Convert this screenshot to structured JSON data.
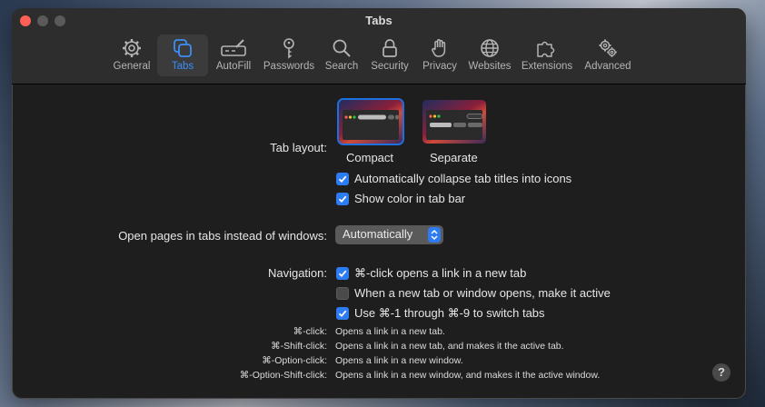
{
  "window": {
    "title": "Tabs"
  },
  "toolbar": {
    "items": [
      {
        "label": "General",
        "icon": "gear-icon"
      },
      {
        "label": "Tabs",
        "icon": "tabs-icon",
        "active": true
      },
      {
        "label": "AutoFill",
        "icon": "pencil-field-icon"
      },
      {
        "label": "Passwords",
        "icon": "key-icon"
      },
      {
        "label": "Search",
        "icon": "magnifier-icon"
      },
      {
        "label": "Security",
        "icon": "lock-icon"
      },
      {
        "label": "Privacy",
        "icon": "hand-icon"
      },
      {
        "label": "Websites",
        "icon": "globe-icon"
      },
      {
        "label": "Extensions",
        "icon": "puzzle-icon"
      },
      {
        "label": "Advanced",
        "icon": "gears-icon"
      }
    ]
  },
  "tab_layout": {
    "label": "Tab layout:",
    "options": [
      {
        "label": "Compact",
        "selected": true
      },
      {
        "label": "Separate",
        "selected": false
      }
    ]
  },
  "checkboxes": {
    "collapse_titles": {
      "label": "Automatically collapse tab titles into icons",
      "checked": true
    },
    "show_color": {
      "label": "Show color in tab bar",
      "checked": true
    }
  },
  "open_pages": {
    "label": "Open pages in tabs instead of windows:",
    "value": "Automatically"
  },
  "navigation": {
    "label": "Navigation:",
    "options": [
      {
        "label": "⌘-click opens a link in a new tab",
        "checked": true
      },
      {
        "label": "When a new tab or window opens, make it active",
        "checked": false
      },
      {
        "label": "Use ⌘-1 through ⌘-9 to switch tabs",
        "checked": true
      }
    ]
  },
  "shortcuts": [
    {
      "key": "⌘-click:",
      "desc": "Opens a link in a new tab."
    },
    {
      "key": "⌘-Shift-click:",
      "desc": "Opens a link in a new tab, and makes it the active tab."
    },
    {
      "key": "⌘-Option-click:",
      "desc": "Opens a link in a new window."
    },
    {
      "key": "⌘-Option-Shift-click:",
      "desc": "Opens a link in a new window, and makes it the active window."
    }
  ],
  "help": {
    "label": "?"
  },
  "colors": {
    "accent": "#2d7cf4",
    "close": "#fe5f57",
    "window_bg": "#1e1e1e",
    "titlebar_bg": "#2d2d2d"
  }
}
